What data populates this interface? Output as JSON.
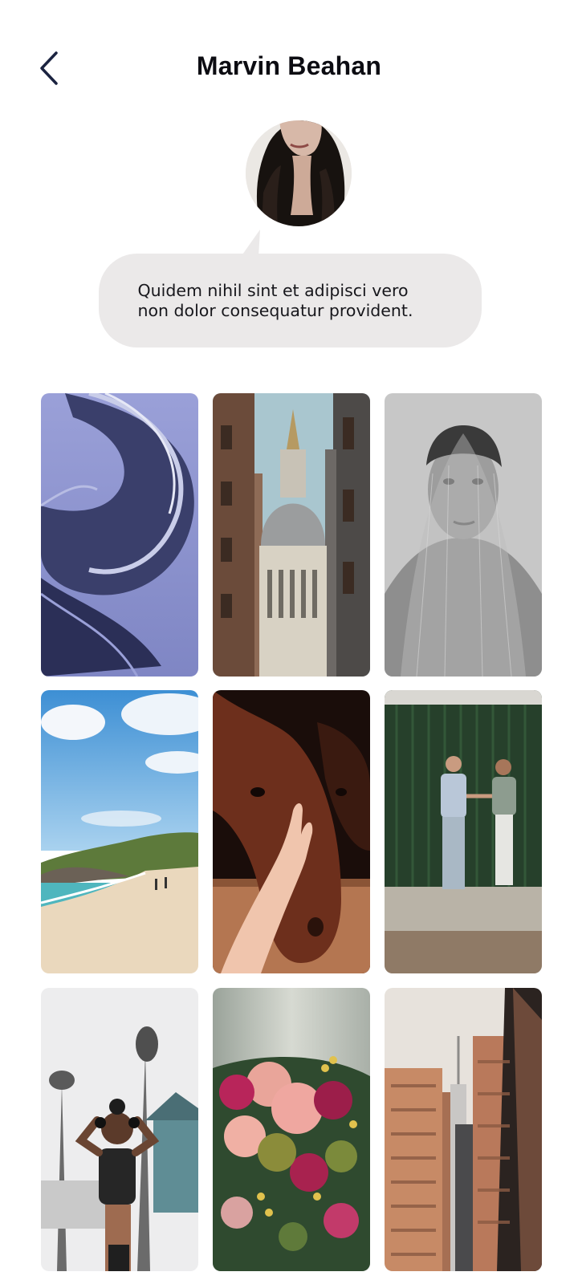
{
  "header": {
    "title": "Marvin Beahan"
  },
  "profile": {
    "bio": "Quidem nihil sint et adipisci vero non dolor consequatur provident."
  },
  "icons": {
    "back": "chevron-left-icon"
  },
  "colors": {
    "title": "#0c0c12",
    "bubble": "#ebe9e9",
    "back_icon": "#1b2340"
  },
  "gallery": {
    "photos": [
      {
        "subject": "spiral-architecture"
      },
      {
        "subject": "cathedral-dome"
      },
      {
        "subject": "veiled-man-portrait"
      },
      {
        "subject": "beach-coastline"
      },
      {
        "subject": "horse-and-hand"
      },
      {
        "subject": "couple-holding-hands"
      },
      {
        "subject": "woman-with-headphones"
      },
      {
        "subject": "flower-bouquet"
      },
      {
        "subject": "city-skyscrapers"
      }
    ]
  }
}
